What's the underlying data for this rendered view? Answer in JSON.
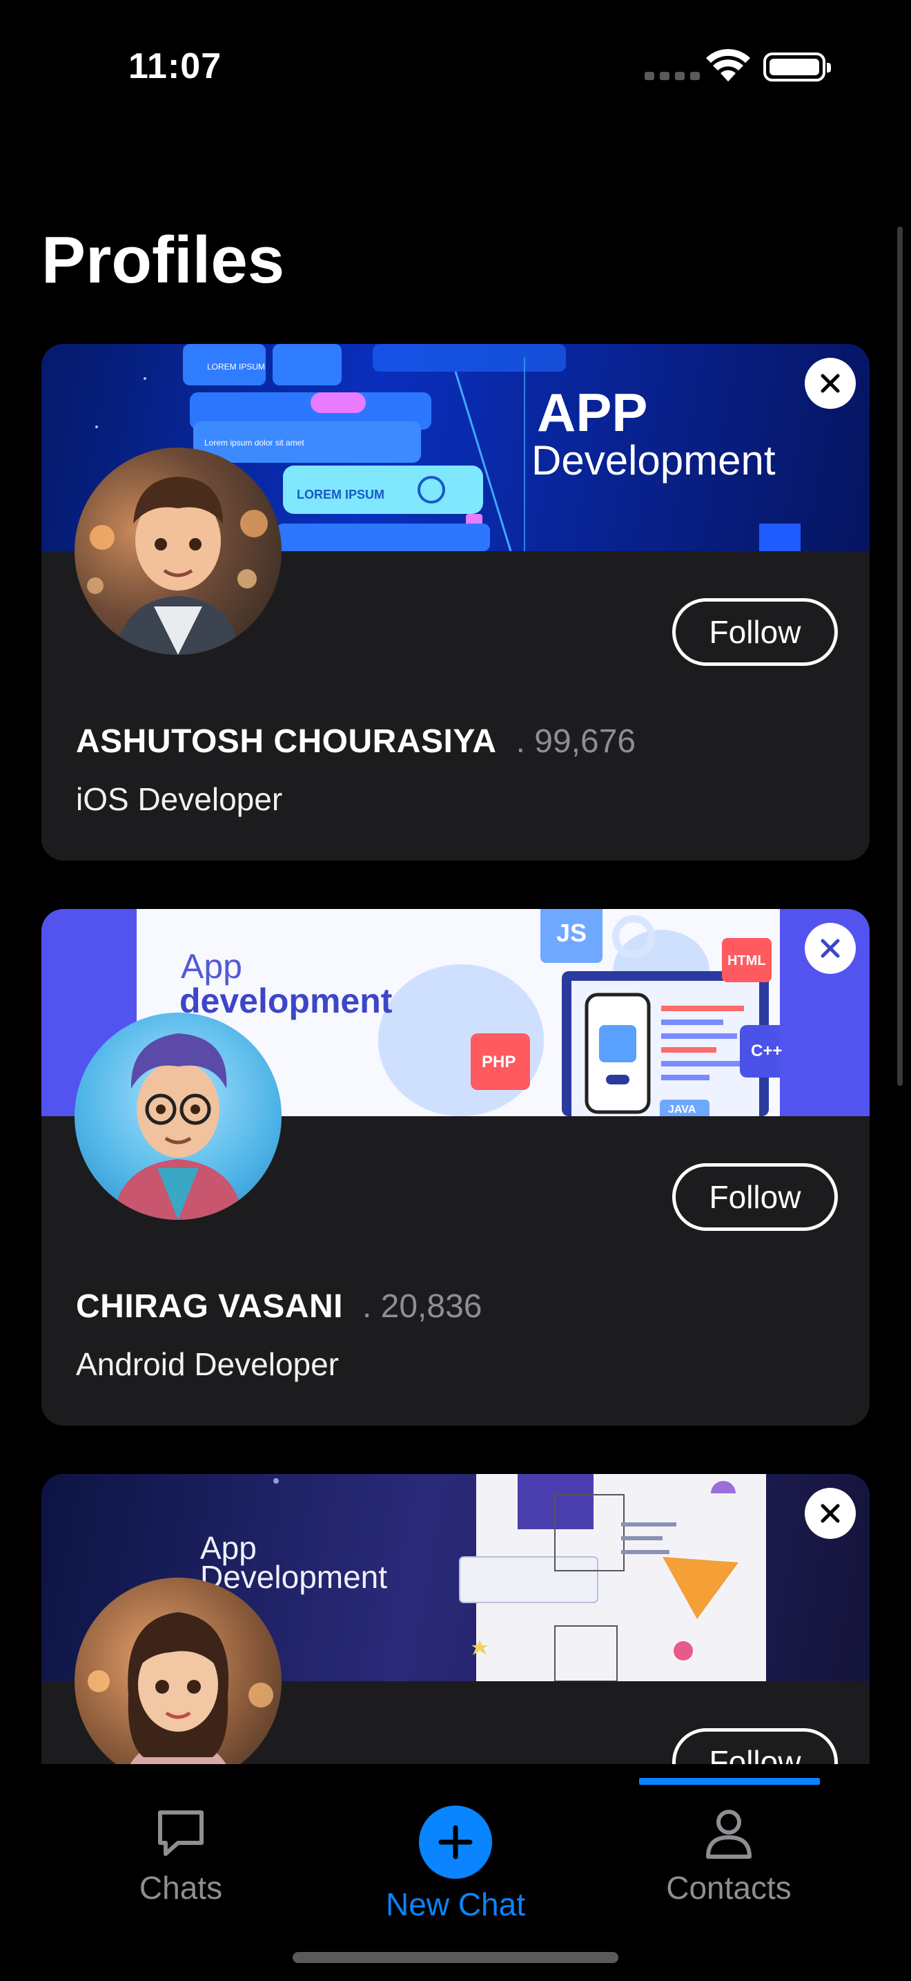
{
  "status_bar": {
    "time": "11:07"
  },
  "page": {
    "title": "Profiles"
  },
  "profiles": [
    {
      "name": "ASHUTOSH CHOURASIYA",
      "count": ". 99,676",
      "role": "iOS Developer",
      "follow_label": "Follow",
      "banner": {
        "headline": "APP",
        "subline": "Development",
        "chip_1": "LOREM IPSUM",
        "chip_2": "LOREM IPSUM",
        "note": "Lorem ipsum dolor sit amet"
      }
    },
    {
      "name": "CHIRAG VASANI",
      "count": ". 20,836",
      "role": "Android Developer",
      "follow_label": "Follow",
      "banner": {
        "headline": "App",
        "subline": "development",
        "tag_js": "JS",
        "tag_html": "HTML",
        "tag_php": "PHP",
        "tag_cpp": "C++",
        "tag_java": "JAVA"
      }
    },
    {
      "name": "",
      "count": "",
      "role": "",
      "follow_label": "Follow",
      "banner": {
        "headline": "App",
        "subline": "Development"
      }
    }
  ],
  "tab_bar": {
    "tabs": [
      {
        "label": "Chats",
        "icon": "chat-bubble-icon"
      },
      {
        "label": "New Chat",
        "icon": "plus-circle-icon"
      },
      {
        "label": "Contacts",
        "icon": "person-icon"
      }
    ],
    "selected": "Contacts"
  },
  "colors": {
    "accent": "#0a84ff",
    "card": "#1c1c1e",
    "background": "#000000"
  }
}
